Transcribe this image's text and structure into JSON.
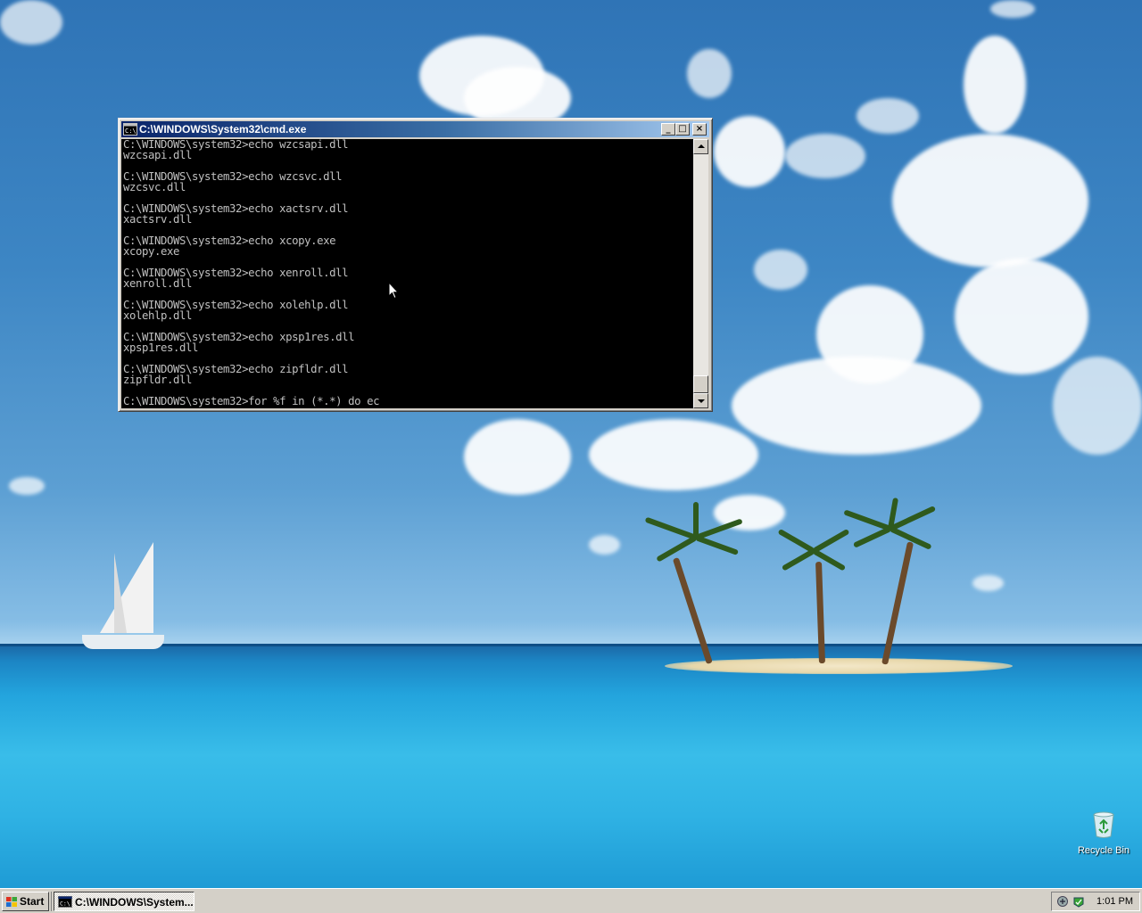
{
  "window": {
    "title": "C:\\WINDOWS\\System32\\cmd.exe",
    "console_lines": [
      "C:\\WINDOWS\\system32>echo wzcsapi.dll",
      "wzcsapi.dll",
      "",
      "C:\\WINDOWS\\system32>echo wzcsvc.dll",
      "wzcsvc.dll",
      "",
      "C:\\WINDOWS\\system32>echo xactsrv.dll",
      "xactsrv.dll",
      "",
      "C:\\WINDOWS\\system32>echo xcopy.exe",
      "xcopy.exe",
      "",
      "C:\\WINDOWS\\system32>echo xenroll.dll",
      "xenroll.dll",
      "",
      "C:\\WINDOWS\\system32>echo xolehlp.dll",
      "xolehlp.dll",
      "",
      "C:\\WINDOWS\\system32>echo xpsp1res.dll",
      "xpsp1res.dll",
      "",
      "C:\\WINDOWS\\system32>echo zipfldr.dll",
      "zipfldr.dll",
      "",
      "C:\\WINDOWS\\system32>for %f in (*.*) do ec"
    ],
    "buttons": {
      "minimize": "_",
      "maximize": "□",
      "close": "×"
    }
  },
  "desktop": {
    "recycle_bin_label": "Recycle Bin"
  },
  "taskbar": {
    "start_label": "Start",
    "task_label": "C:\\WINDOWS\\System...",
    "clock": "1:01 PM"
  },
  "colors": {
    "title_active_start": "#0a246a",
    "title_active_end": "#a6caf0",
    "console_bg": "#000000",
    "console_fg": "#c0c0c0",
    "chrome": "#d4d0c8"
  },
  "icons": [
    "cmd-icon",
    "windows-flag-icon",
    "recycle-bin-icon",
    "network-icon",
    "security-icon",
    "mouse-cursor-icon"
  ]
}
